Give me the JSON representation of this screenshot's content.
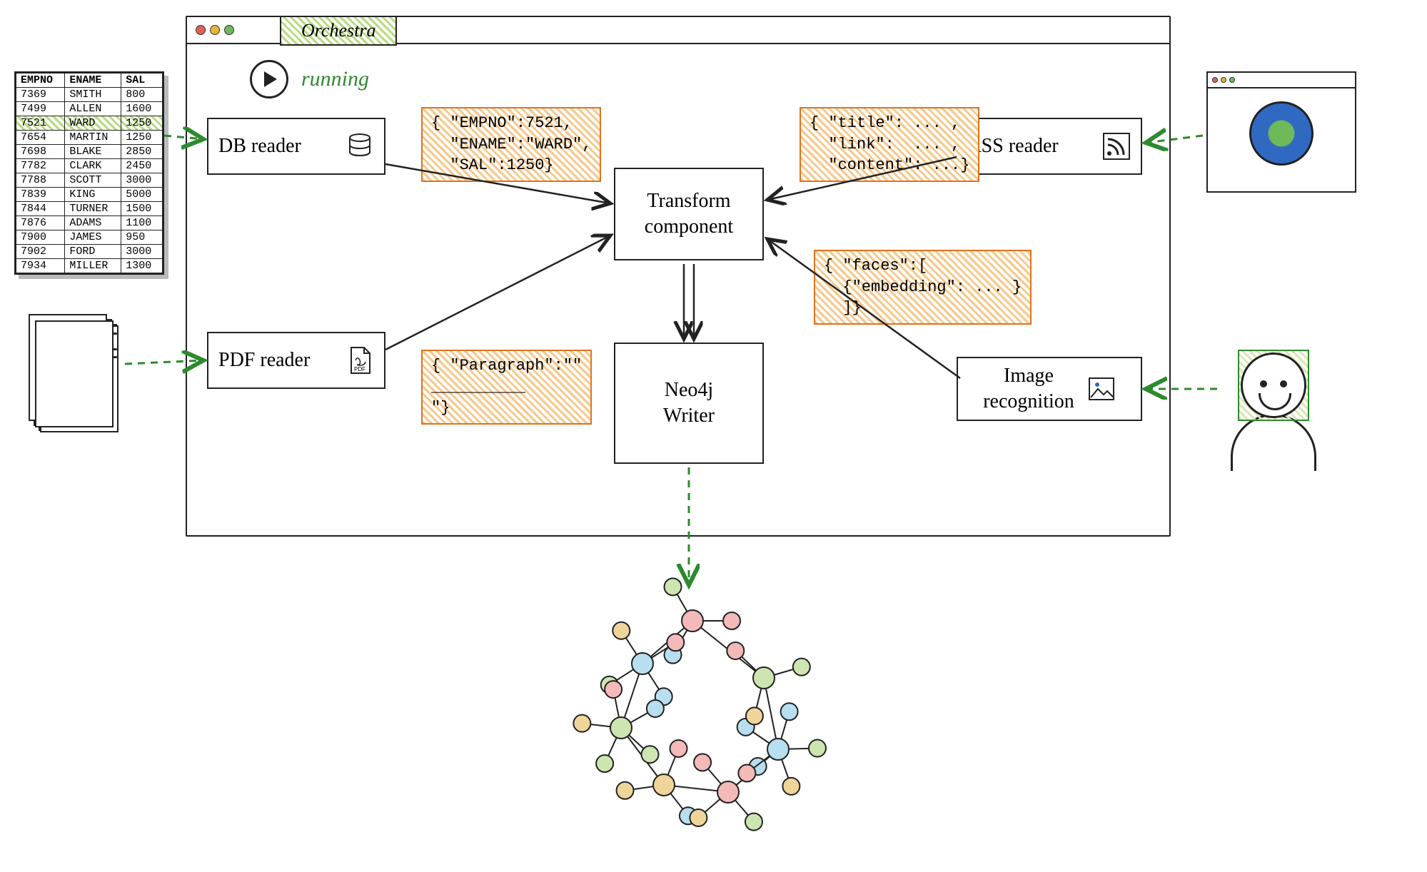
{
  "app": {
    "title_tab": "Orchestra",
    "status": "running"
  },
  "components": {
    "db_reader": "DB reader",
    "pdf_reader": "PDF reader",
    "rss_reader": "RSS reader",
    "image_recognition": "Image\nrecognition",
    "transform": "Transform\ncomponent",
    "neo4j_writer": "Neo4j\nWriter"
  },
  "payloads": {
    "db": "{ \"EMPNO\":7521,\n  \"ENAME\":\"WARD\",\n  \"SAL\":1250}",
    "rss": "{ \"title\": ... ,\n  \"link\":  ... ,\n  \"content\": ...}",
    "faces": "{ \"faces\":[\n  {\"embedding\": ... }\n  ]}",
    "pdf": "{ \"Paragraph\":\"\"\n__________\n\"}"
  },
  "db_table": {
    "headers": [
      "EMPNO",
      "ENAME",
      "SAL"
    ],
    "rows": [
      [
        "7369",
        "SMITH",
        "800"
      ],
      [
        "7499",
        "ALLEN",
        "1600"
      ],
      [
        "7521",
        "WARD",
        "1250"
      ],
      [
        "7654",
        "MARTIN",
        "1250"
      ],
      [
        "7698",
        "BLAKE",
        "2850"
      ],
      [
        "7782",
        "CLARK",
        "2450"
      ],
      [
        "7788",
        "SCOTT",
        "3000"
      ],
      [
        "7839",
        "KING",
        "5000"
      ],
      [
        "7844",
        "TURNER",
        "1500"
      ],
      [
        "7876",
        "ADAMS",
        "1100"
      ],
      [
        "7900",
        "JAMES",
        "950"
      ],
      [
        "7902",
        "FORD",
        "3000"
      ],
      [
        "7934",
        "MILLER",
        "1300"
      ]
    ],
    "highlight_row_index": 2
  }
}
